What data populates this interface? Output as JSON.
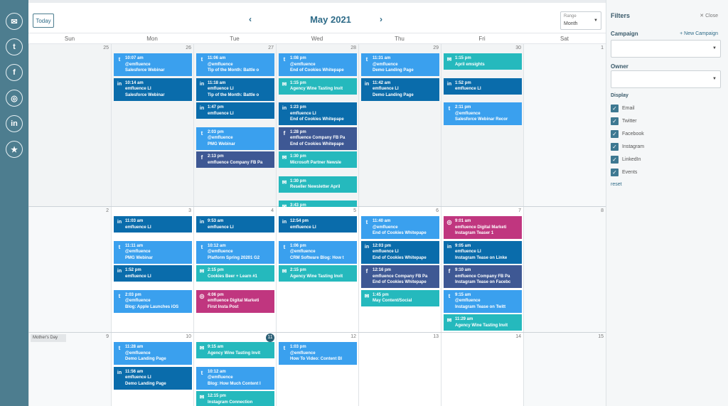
{
  "rail": [
    "email-icon",
    "twitter-icon",
    "facebook-icon",
    "instagram-icon",
    "linkedin-icon",
    "star-icon"
  ],
  "header": {
    "today": "Today",
    "prev": "‹",
    "next": "›",
    "title": "May 2021",
    "range_label": "Range",
    "range_value": "Month"
  },
  "days": [
    "Sun",
    "Mon",
    "Tue",
    "Wed",
    "Thu",
    "Fri",
    "Sat"
  ],
  "colors": {
    "twitter": "#3aa0ee",
    "linkedin": "#0a6cab",
    "email": "#25b9bd",
    "facebook": "#3e5894",
    "instagram": "#c0367f",
    "rail": "#4d7d8f"
  },
  "weeks": [
    {
      "nums": [
        "25",
        "26",
        "27",
        "28",
        "29",
        "30",
        "1"
      ],
      "today_col": -1,
      "holiday": ""
    },
    {
      "nums": [
        "2",
        "3",
        "4",
        "5",
        "6",
        "7",
        "8"
      ],
      "today_col": -1,
      "holiday": ""
    },
    {
      "nums": [
        "9",
        "10",
        "11",
        "12",
        "13",
        "14",
        "15"
      ],
      "today_col": 2,
      "holiday": "Mother's Day"
    }
  ],
  "events": [
    {
      "w": 0,
      "d": 1,
      "row": 0,
      "type": "twitter",
      "time": "10:07 am",
      "l1": "@emfluence",
      "l2": "Salesforce Webinar"
    },
    {
      "w": 0,
      "d": 1,
      "row": 1,
      "type": "linkedin",
      "time": "10:14 am",
      "l1": "emfluence LI",
      "l2": "Salesforce Webinar"
    },
    {
      "w": 0,
      "d": 2,
      "row": 0,
      "type": "twitter",
      "time": "11:06 am",
      "l1": "@emfluence",
      "l2": "Tip of the Month: Battle o"
    },
    {
      "w": 0,
      "d": 2,
      "row": 1,
      "type": "linkedin",
      "time": "11:18 am",
      "l1": "emfluence LI",
      "l2": "Tip of the Month: Battle o"
    },
    {
      "w": 0,
      "d": 2,
      "row": 2,
      "type": "linkedin",
      "time": "1:47 pm",
      "l1": "emfluence LI",
      "l2": ""
    },
    {
      "w": 0,
      "d": 2,
      "row": 3,
      "type": "twitter",
      "time": "2:03 pm",
      "l1": "@emfluence",
      "l2": "PMG Webinar"
    },
    {
      "w": 0,
      "d": 2,
      "row": 4,
      "type": "facebook",
      "time": "2:13 pm",
      "l1": "emfluence Company FB Pa",
      "l2": ""
    },
    {
      "w": 0,
      "d": 3,
      "row": 0,
      "type": "twitter",
      "time": "1:08 pm",
      "l1": "@emfluence",
      "l2": "End of Cookies Whitepape"
    },
    {
      "w": 0,
      "d": 3,
      "row": 1,
      "type": "email",
      "time": "1:15 pm",
      "l1": "Agency Wine Tasting Invit",
      "l2": ""
    },
    {
      "w": 0,
      "d": 3,
      "row": 2,
      "type": "linkedin",
      "time": "1:23 pm",
      "l1": "emfluence LI",
      "l2": "End of Cookies Whitepape"
    },
    {
      "w": 0,
      "d": 3,
      "row": 3,
      "type": "facebook",
      "time": "1:28 pm",
      "l1": "emfluence Company FB Pa",
      "l2": "End of Cookies Whitepape"
    },
    {
      "w": 0,
      "d": 3,
      "row": 4,
      "type": "email",
      "time": "1:30 pm",
      "l1": "Microsoft Partner Newsle",
      "l2": ""
    },
    {
      "w": 0,
      "d": 3,
      "row": 5,
      "type": "email",
      "time": "1:30 pm",
      "l1": "Reseller Newsletter April",
      "l2": ""
    },
    {
      "w": 0,
      "d": 3,
      "row": 6,
      "type": "email",
      "time": "3:43 pm",
      "l1": "Salesforce Webinar Follov",
      "l2": ""
    },
    {
      "w": 0,
      "d": 4,
      "row": 0,
      "type": "twitter",
      "time": "11:31 am",
      "l1": "@emfluence",
      "l2": "Demo Landing Page"
    },
    {
      "w": 0,
      "d": 4,
      "row": 1,
      "type": "linkedin",
      "time": "11:42 am",
      "l1": "emfluence LI",
      "l2": "Demo Landing Page"
    },
    {
      "w": 0,
      "d": 5,
      "row": 0,
      "type": "email",
      "time": "1:15 pm",
      "l1": "April emsights",
      "l2": ""
    },
    {
      "w": 0,
      "d": 5,
      "row": 1,
      "type": "linkedin",
      "time": "1:52 pm",
      "l1": "emfluence LI",
      "l2": ""
    },
    {
      "w": 0,
      "d": 5,
      "row": 2,
      "type": "twitter",
      "time": "2:11 pm",
      "l1": "@emfluence",
      "l2": "Salesforce Webinar Recor"
    },
    {
      "w": 1,
      "d": 1,
      "row": 0,
      "type": "linkedin",
      "time": "11:03 am",
      "l1": "emfluence LI",
      "l2": ""
    },
    {
      "w": 1,
      "d": 1,
      "row": 1,
      "type": "twitter",
      "time": "11:11 am",
      "l1": "@emfluence",
      "l2": "PMG Webinar"
    },
    {
      "w": 1,
      "d": 1,
      "row": 2,
      "type": "linkedin",
      "time": "1:52 pm",
      "l1": "emfluence LI",
      "l2": ""
    },
    {
      "w": 1,
      "d": 1,
      "row": 3,
      "type": "twitter",
      "time": "2:03 pm",
      "l1": "@emfluence",
      "l2": "Blog: Apple Launches iOS"
    },
    {
      "w": 1,
      "d": 2,
      "row": 0,
      "type": "linkedin",
      "time": "9:53 am",
      "l1": "emfluence LI",
      "l2": ""
    },
    {
      "w": 1,
      "d": 2,
      "row": 1,
      "type": "twitter",
      "time": "10:12 am",
      "l1": "@emfluence",
      "l2": "Platform Spring 20201 G2"
    },
    {
      "w": 1,
      "d": 2,
      "row": 2,
      "type": "email",
      "time": "2:15 pm",
      "l1": "Cookies Beer + Learn #1",
      "l2": ""
    },
    {
      "w": 1,
      "d": 2,
      "row": 3,
      "type": "instagram",
      "time": "4:06 pm",
      "l1": "emfluence Digital Marketi",
      "l2": "First Insta Post"
    },
    {
      "w": 1,
      "d": 3,
      "row": 0,
      "type": "linkedin",
      "time": "12:54 pm",
      "l1": "emfluence LI",
      "l2": ""
    },
    {
      "w": 1,
      "d": 3,
      "row": 1,
      "type": "twitter",
      "time": "1:06 pm",
      "l1": "@emfluence",
      "l2": "CRM Software Blog: How t"
    },
    {
      "w": 1,
      "d": 3,
      "row": 2,
      "type": "email",
      "time": "2:15 pm",
      "l1": "Agency Wine Tasting Invit",
      "l2": ""
    },
    {
      "w": 1,
      "d": 4,
      "row": 0,
      "type": "twitter",
      "time": "11:40 am",
      "l1": "@emfluence",
      "l2": "End of Cookies Whitepape"
    },
    {
      "w": 1,
      "d": 4,
      "row": 1,
      "type": "linkedin",
      "time": "12:03 pm",
      "l1": "emfluence LI",
      "l2": "End of Cookies Whitepape"
    },
    {
      "w": 1,
      "d": 4,
      "row": 2,
      "type": "facebook",
      "time": "12:16 pm",
      "l1": "emfluence Company FB Pa",
      "l2": "End of Cookies Whitepape"
    },
    {
      "w": 1,
      "d": 4,
      "row": 3,
      "type": "email",
      "time": "1:45 pm",
      "l1": "May Content/Social",
      "l2": ""
    },
    {
      "w": 1,
      "d": 5,
      "row": 0,
      "type": "instagram",
      "time": "9:01 am",
      "l1": "emfluence Digital Marketi",
      "l2": "Instagram Teaser 1"
    },
    {
      "w": 1,
      "d": 5,
      "row": 1,
      "type": "linkedin",
      "time": "9:05 am",
      "l1": "emfluence LI",
      "l2": "Instagram Tease on Linke"
    },
    {
      "w": 1,
      "d": 5,
      "row": 2,
      "type": "facebook",
      "time": "9:10 am",
      "l1": "emfluence Company FB Pa",
      "l2": "Instagram Tease on Facebc"
    },
    {
      "w": 1,
      "d": 5,
      "row": 3,
      "type": "twitter",
      "time": "9:15 am",
      "l1": "@emfluence",
      "l2": "Instagram Tease on Twitt"
    },
    {
      "w": 1,
      "d": 5,
      "row": 4,
      "type": "email",
      "time": "11:29 am",
      "l1": "Agency Wine Tasting Invit",
      "l2": ""
    },
    {
      "w": 2,
      "d": 1,
      "row": 0,
      "type": "twitter",
      "time": "11:28 am",
      "l1": "@emfluence",
      "l2": "Demo Landing Page"
    },
    {
      "w": 2,
      "d": 1,
      "row": 1,
      "type": "linkedin",
      "time": "11:56 am",
      "l1": "emfluence LI",
      "l2": "Demo Landing Page"
    },
    {
      "w": 2,
      "d": 2,
      "row": 0,
      "type": "email",
      "time": "9:15 am",
      "l1": "Agency Wine Tasting Invit",
      "l2": ""
    },
    {
      "w": 2,
      "d": 2,
      "row": 1,
      "type": "twitter",
      "time": "10:12 am",
      "l1": "@emfluence",
      "l2": "Blog: How Much Content I"
    },
    {
      "w": 2,
      "d": 2,
      "row": 2,
      "type": "email",
      "time": "12:15 pm",
      "l1": "Instagram Connection",
      "l2": ""
    },
    {
      "w": 2,
      "d": 3,
      "row": 0,
      "type": "twitter",
      "time": "1:03 pm",
      "l1": "@emfluence",
      "l2": "How To Video: Content Bl"
    }
  ],
  "filters": {
    "title": "Filters",
    "close": "Close",
    "campaign_label": "Campaign",
    "new_campaign": "+ New Campaign",
    "owner_label": "Owner",
    "display_label": "Display",
    "options": [
      "Email",
      "Twitter",
      "Facebook",
      "Instagram",
      "LinkedIn",
      "Events"
    ],
    "checked": [
      true,
      true,
      true,
      true,
      true,
      true
    ],
    "reset": "reset"
  }
}
